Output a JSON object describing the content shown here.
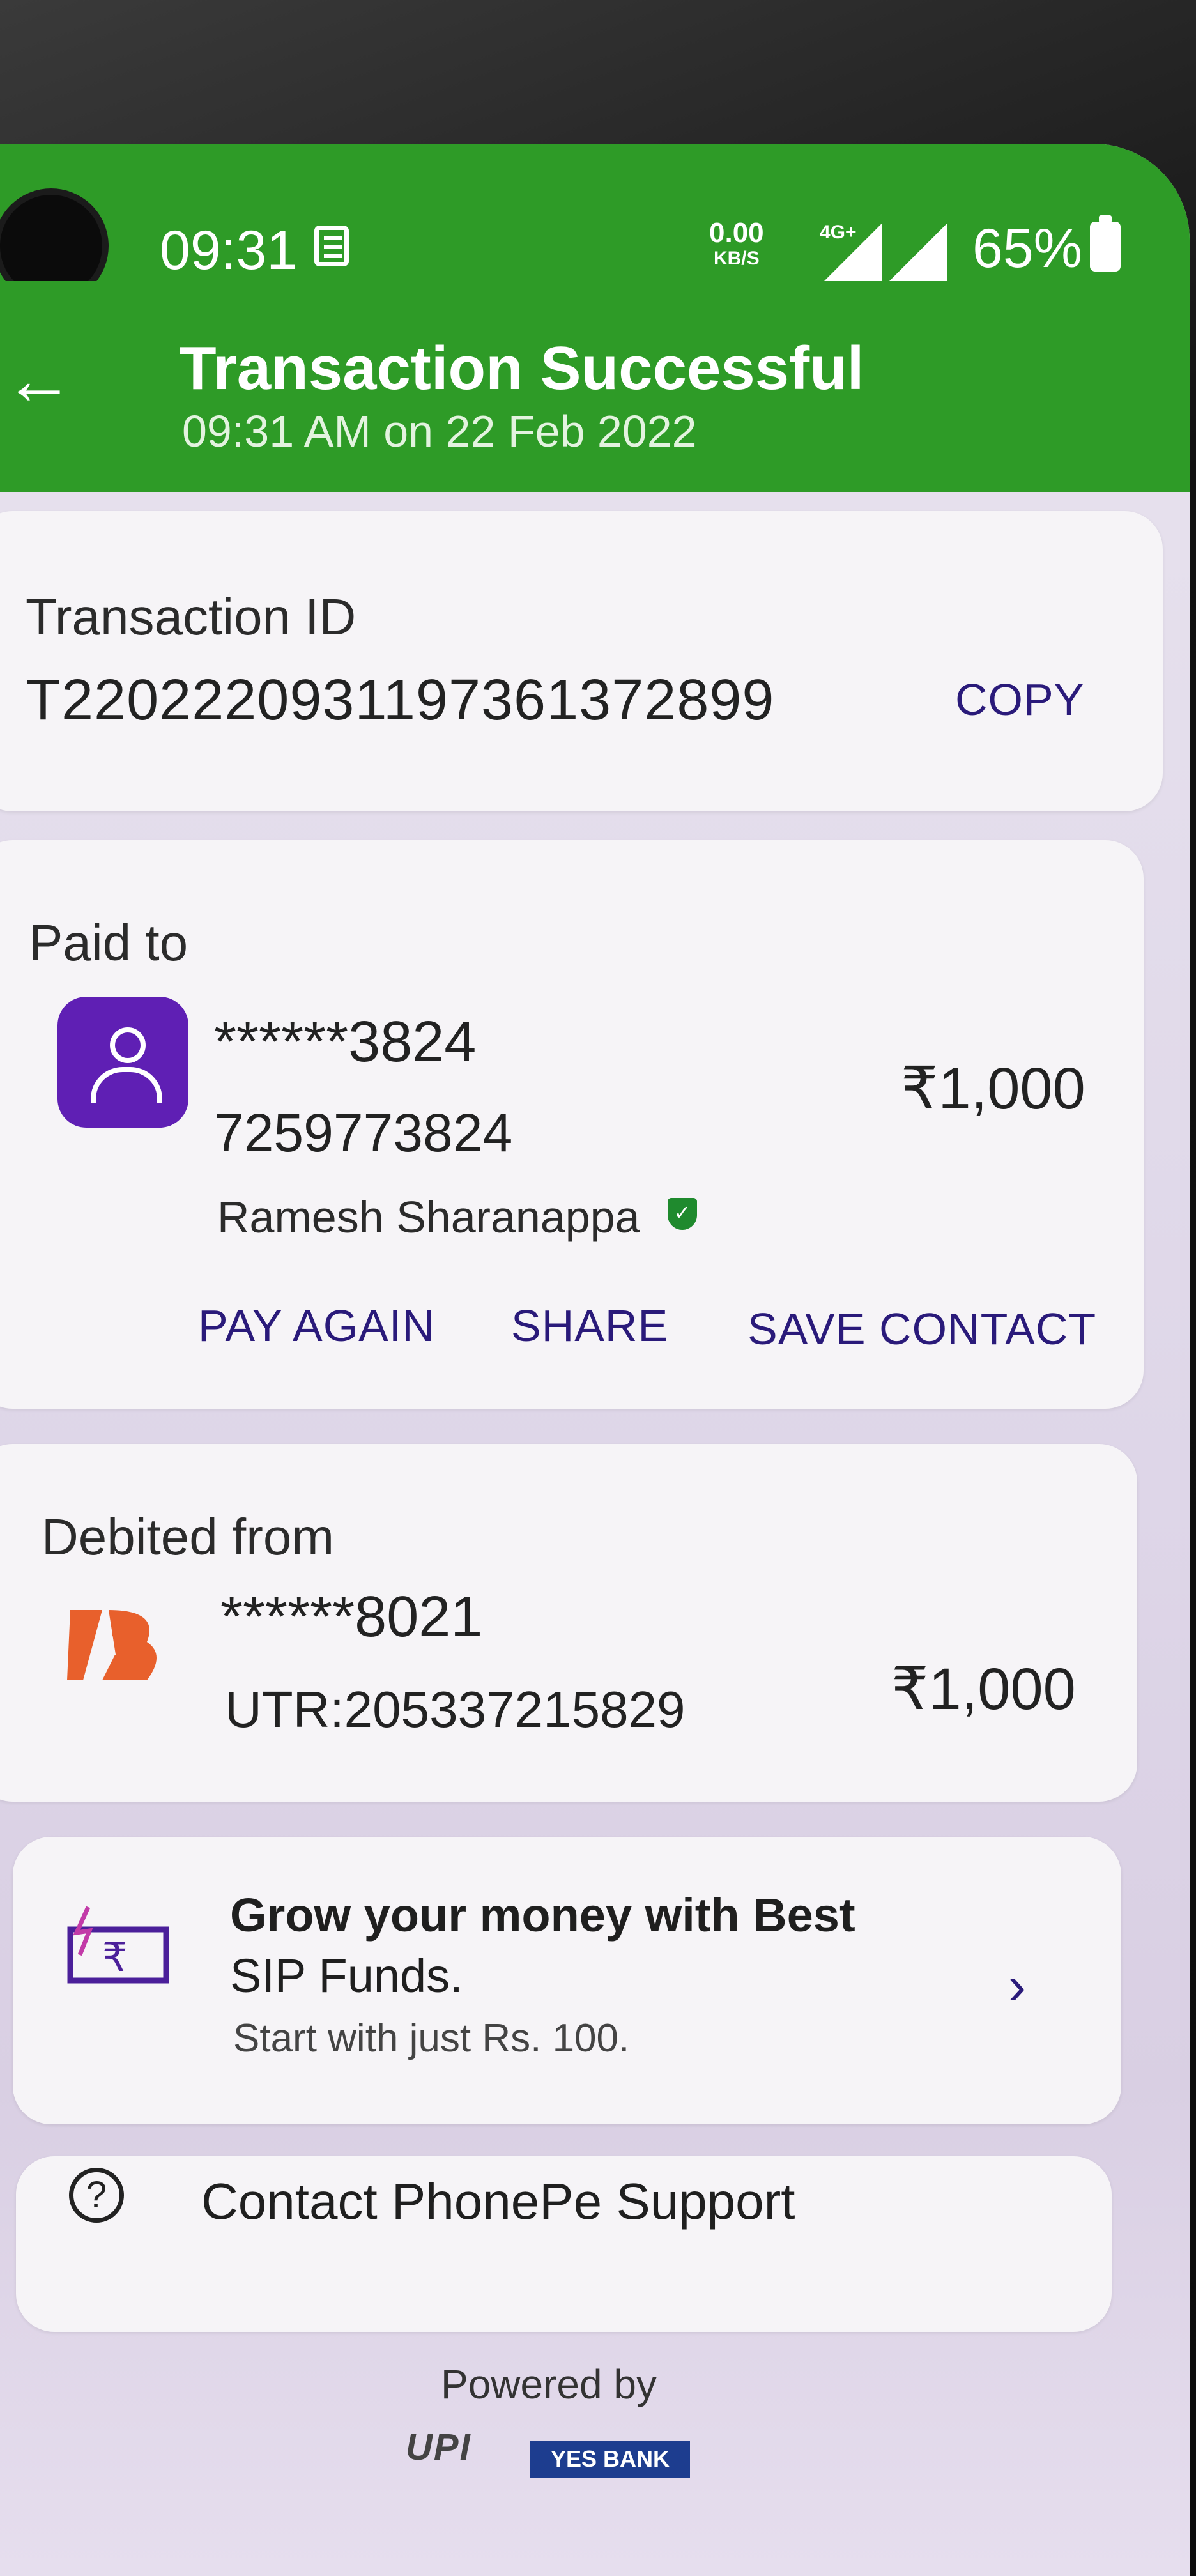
{
  "status_bar": {
    "time": "09:31",
    "net_speed": "0.00",
    "net_unit": "KB/S",
    "network": "4G+",
    "battery": "65%"
  },
  "header": {
    "title": "Transaction Successful",
    "subtitle": "09:31 AM on 22 Feb 2022",
    "color": "#2e9b27"
  },
  "transaction": {
    "label": "Transaction ID",
    "id": "T2202220931197361372899",
    "copy_label": "COPY"
  },
  "paid_to": {
    "label": "Paid to",
    "masked_account": "******3824",
    "phone": "7259773824",
    "name": "Ramesh  Sharanappa",
    "amount": "₹1,000",
    "actions": [
      "PAY AGAIN",
      "SHARE",
      "SAVE CONTACT"
    ]
  },
  "debited_from": {
    "label": "Debited from",
    "masked_account": "******8021",
    "utr": "UTR:205337215829",
    "amount": "₹1,000"
  },
  "promo": {
    "line1": "Grow your money with Best",
    "line2": "SIP Funds.",
    "subtitle": "Start with just Rs. 100."
  },
  "support": {
    "label": "Contact PhonePe Support"
  },
  "footer": {
    "powered_by": "Powered by",
    "upi": "UPI",
    "bank": "YES BANK"
  },
  "icons": {
    "back": "arrow-left-icon",
    "avatar": "person-icon",
    "verified": "shield-check-icon",
    "bank": "bank-of-baroda-logo",
    "sip": "rupee-wallet-icon",
    "help": "question-circle-icon",
    "chevron": "chevron-right-icon"
  }
}
